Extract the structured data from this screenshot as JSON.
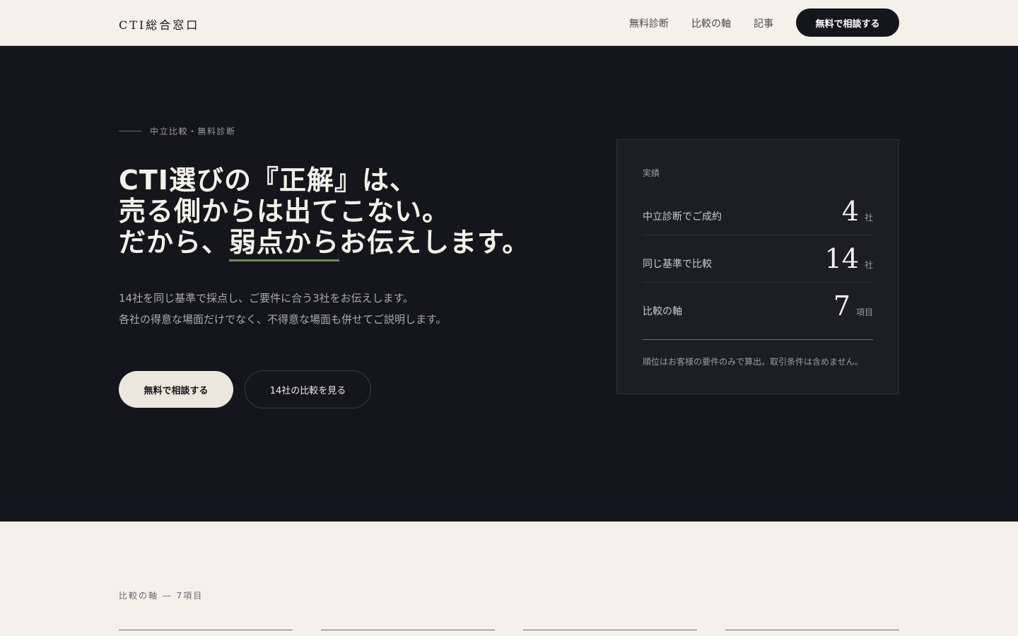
{
  "header": {
    "brand": "CTI総合窓口",
    "nav": [
      "無料診断",
      "比較の軸",
      "記事"
    ],
    "cta_label": "無料で相談する"
  },
  "hero": {
    "eyebrow": "中立比較・無料診断",
    "headline": {
      "line1_prefix": "CTI",
      "line1_rest": "選びの『正解』は、",
      "line2": "売る側からは出てこない。",
      "line3_prefix": "だから、",
      "line3_highlight": "弱点から",
      "line3_suffix": "お伝えします。"
    },
    "lead": [
      "14社を同じ基準で採点し、ご要件に合う3社をお伝えします。",
      "各社の得意な場面だけでなく、不得意な場面も併せてご説明します。"
    ],
    "primary_button": "無料で相談する",
    "secondary_button": "14社の比較を見る"
  },
  "stats": {
    "title": "実績",
    "rows": [
      {
        "label": "中立診断でご成約",
        "value": "4",
        "unit": "社"
      },
      {
        "label": "同じ基準で比較",
        "value": "14",
        "unit": "社"
      },
      {
        "label": "比較の軸",
        "value": "7",
        "unit": "項目"
      }
    ],
    "note": "順位はお客様の要件のみで算出。取引条件は含めません。"
  },
  "axis_section": {
    "label": "比較の軸 — 7項目"
  },
  "colors": {
    "page_bg": "#f3f1ea",
    "hero_bg": "#15161b",
    "card_bg": "#1c1e24",
    "accent_underline": "#6c8a60",
    "button_light": "#ebe7dc"
  }
}
